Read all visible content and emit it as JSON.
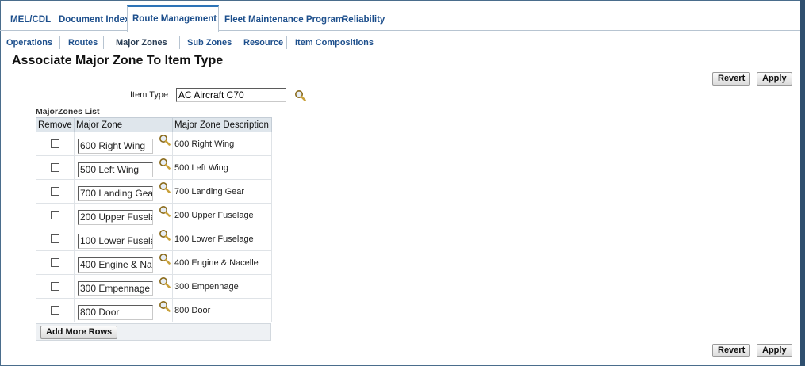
{
  "top_tabs": [
    "MEL/CDL",
    "Document Index",
    "Route Management",
    "Fleet Maintenance Program",
    "Reliability"
  ],
  "sub_tabs": [
    "Operations",
    "Routes",
    "Major Zones",
    "Sub Zones",
    "Resource",
    "Item Compositions"
  ],
  "page_title": "Associate Major Zone To Item Type",
  "buttons": {
    "revert": "Revert",
    "apply": "Apply",
    "add_more_rows": "Add More Rows"
  },
  "item_type": {
    "label": "Item Type",
    "value": "AC Aircraft C70"
  },
  "grid": {
    "title": "MajorZones List",
    "headers": [
      "Remove",
      "Major Zone",
      "Major Zone Description"
    ],
    "rows": [
      {
        "zone": "600 Right Wing",
        "desc": "600 Right Wing"
      },
      {
        "zone": "500 Left Wing",
        "desc": "500 Left Wing"
      },
      {
        "zone": "700 Landing Gea",
        "desc": "700 Landing Gear"
      },
      {
        "zone": "200 Upper Fusela",
        "desc": "200 Upper Fuselage"
      },
      {
        "zone": "100 Lower Fusela",
        "desc": "100 Lower Fuselage"
      },
      {
        "zone": "400 Engine & Na",
        "desc": "400 Engine & Nacelle"
      },
      {
        "zone": "300 Empennage",
        "desc": "300 Empennage"
      },
      {
        "zone": "800 Door",
        "desc": "800 Door"
      }
    ]
  },
  "icons": {
    "lov": "magnifier-search-icon"
  },
  "colors": {
    "link": "#1d4f8c",
    "active_tab_border": "#2d74b8",
    "header_bg": "#dfe6ec"
  }
}
